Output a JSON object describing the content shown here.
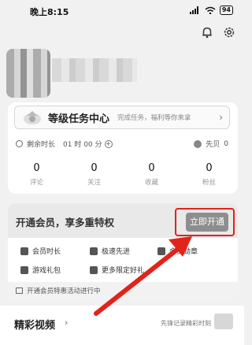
{
  "status_bar": {
    "time": "晚上8:15",
    "battery": "94"
  },
  "top_actions": {
    "notification_icon": "bell-icon",
    "settings_icon": "gear-icon"
  },
  "task_center": {
    "title": "等级任务中心",
    "subtitle": "完成任务，福利等你来拿",
    "arrow": "›"
  },
  "remaining": {
    "label": "剩余时长",
    "value": "01 时 00 分",
    "plus": "+"
  },
  "xianbei": {
    "label": "先贝",
    "value": "0"
  },
  "stats": [
    {
      "value": "0",
      "label": "评论"
    },
    {
      "value": "0",
      "label": "关注"
    },
    {
      "value": "0",
      "label": "收藏"
    },
    {
      "value": "0",
      "label": "粉丝"
    }
  ],
  "vip": {
    "title": "开通会员，享多重特权",
    "open_button": "立即开通",
    "perks": [
      "会员时长",
      "极速先进",
      "会员勋章",
      "游戏礼包",
      "更多限定好礼"
    ],
    "footer": "开通会员特惠活动进行中"
  },
  "featured": {
    "title": "精彩视频",
    "chevron": "›",
    "subtitle": "先锋记录精彩时刻"
  },
  "colors": {
    "highlight": "#e2231a",
    "button_gray": "#8e8e8e"
  }
}
